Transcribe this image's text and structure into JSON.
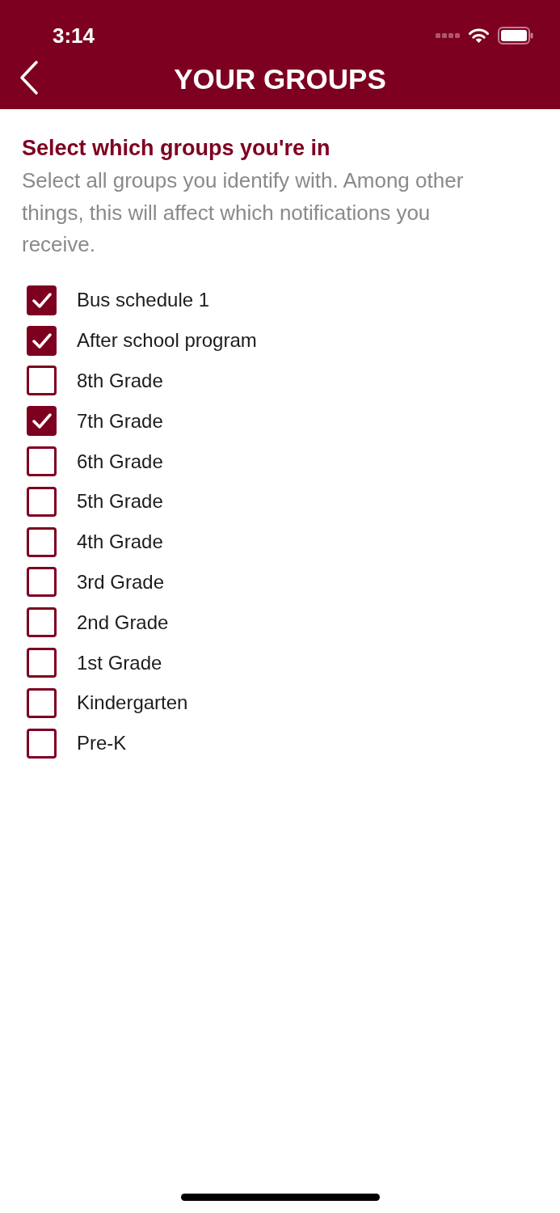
{
  "status_bar": {
    "time": "3:14"
  },
  "nav_bar": {
    "title": "YOUR GROUPS"
  },
  "section": {
    "heading": "Select which groups you're in",
    "description": "Select all groups you identify with. Among other things, this will affect which notifications you receive."
  },
  "groups": [
    {
      "label": "Bus schedule 1",
      "checked": true
    },
    {
      "label": "After school program",
      "checked": true
    },
    {
      "label": "8th Grade",
      "checked": false
    },
    {
      "label": "7th Grade",
      "checked": true
    },
    {
      "label": "6th Grade",
      "checked": false
    },
    {
      "label": "5th Grade",
      "checked": false
    },
    {
      "label": "4th Grade",
      "checked": false
    },
    {
      "label": "3rd Grade",
      "checked": false
    },
    {
      "label": "2nd Grade",
      "checked": false
    },
    {
      "label": "1st Grade",
      "checked": false
    },
    {
      "label": "Kindergarten",
      "checked": false
    },
    {
      "label": "Pre-K",
      "checked": false
    }
  ]
}
